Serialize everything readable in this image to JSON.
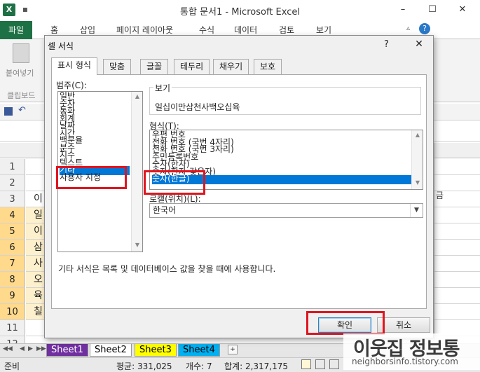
{
  "window": {
    "title": "통합 문서1 - Microsoft Excel",
    "app_icon": "X",
    "minimize": "–",
    "maximize": "☐",
    "close": "✕"
  },
  "ribbon": {
    "file_tab": "파일",
    "tabs": [
      "홈",
      "삽입",
      "페이지 레이아웃",
      "수식",
      "데이터",
      "검토",
      "보기"
    ],
    "paste_label": "붙여넣기",
    "clipboard_label": "클립보드"
  },
  "grid": {
    "rows": [
      {
        "num": "1",
        "a": "",
        "sel": false,
        "fill": false
      },
      {
        "num": "2",
        "a": "",
        "sel": false,
        "fill": false
      },
      {
        "num": "3",
        "a": "이",
        "sel": false,
        "fill": false
      },
      {
        "num": "4",
        "a": "일",
        "sel": true,
        "fill": true
      },
      {
        "num": "5",
        "a": "이",
        "sel": true,
        "fill": true
      },
      {
        "num": "6",
        "a": "삼",
        "sel": true,
        "fill": true
      },
      {
        "num": "7",
        "a": "사",
        "sel": true,
        "fill": true
      },
      {
        "num": "8",
        "a": "오",
        "sel": true,
        "fill": true
      },
      {
        "num": "9",
        "a": "육",
        "sel": true,
        "fill": true
      },
      {
        "num": "10",
        "a": "칠",
        "sel": true,
        "fill": true
      },
      {
        "num": "11",
        "a": "",
        "sel": false,
        "fill": false
      },
      {
        "num": "12",
        "a": "",
        "sel": false,
        "fill": false
      }
    ],
    "right_header_fragment": "금"
  },
  "sheets": {
    "tabs": [
      {
        "label": "Sheet1",
        "color": "#7030a0",
        "text": "#ffffff",
        "active": false
      },
      {
        "label": "Sheet2",
        "color": "#ffffff",
        "text": "#000000",
        "active": true
      },
      {
        "label": "Sheet3",
        "color": "#ffff00",
        "text": "#000000",
        "active": false
      },
      {
        "label": "Sheet4",
        "color": "#00b0f0",
        "text": "#000000",
        "active": false
      }
    ]
  },
  "status": {
    "ready": "준비",
    "average": "평균: 331,025",
    "count": "개수: 7",
    "sum": "합계: 2,317,175"
  },
  "dialog": {
    "title": "셀 서식",
    "help": "?",
    "close": "✕",
    "tabs": [
      "표시 형식",
      "맞춤",
      "글꼴",
      "테두리",
      "채우기",
      "보호"
    ],
    "category_label": "범주(C):",
    "categories": [
      "일반",
      "숫자",
      "통화",
      "회계",
      "날짜",
      "시간",
      "백분율",
      "분수",
      "지수",
      "텍스트",
      "기타",
      "사용자 지정"
    ],
    "selected_category": "기타",
    "sample_label": "보기",
    "sample_value": "일십이만삼천사백오십육",
    "type_label": "형식(T):",
    "types": [
      "우편 번호",
      "전화 번호 (국번 4자리)",
      "전화 번호 (국번 3자리)",
      "주민등록번호",
      "숫자(한자)",
      "숫자(한자-갖은자)",
      "숫자(한글)"
    ],
    "selected_type": "숫자(한글)",
    "locale_label": "로캘(위치)(L):",
    "locale_value": "한국어",
    "description": "기타 서식은 목록 및 데이터베이스 값을 찾을 때에 사용합니다.",
    "ok": "확인",
    "cancel": "취소"
  },
  "watermark": {
    "main": "이웃집 정보통",
    "sub": "neighborsinfo.tistory.com"
  },
  "colors": {
    "excel_green": "#1e7145",
    "selection_blue": "#0078d7",
    "highlight_red": "#e1141e"
  }
}
